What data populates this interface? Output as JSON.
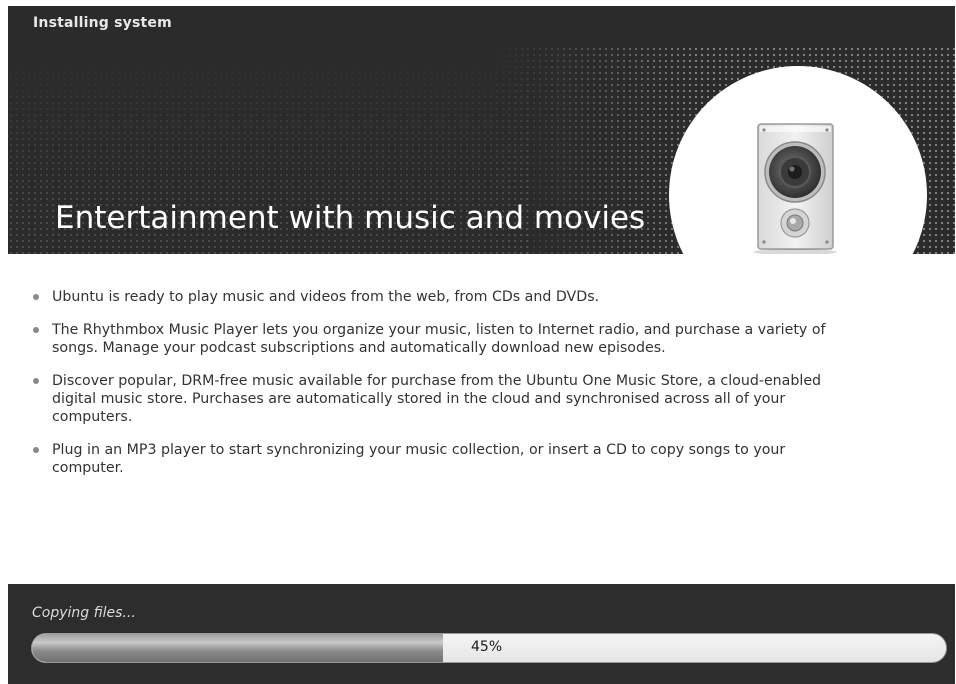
{
  "window": {
    "title": "Installing system"
  },
  "slide": {
    "title": "Entertainment with music and movies",
    "illustration_icon": "speaker-icon",
    "bullets": [
      "Ubuntu is ready to play music and videos from the web, from CDs and DVDs.",
      "The Rhythmbox Music Player lets you organize your music, listen to Internet radio, and purchase a variety of songs. Manage your podcast subscriptions and automatically download new episodes.",
      "Discover popular, DRM-free music available for purchase from the Ubuntu One Music Store, a cloud-enabled digital music store. Purchases are automatically stored in the cloud and synchronised across all of your computers.",
      "Plug in an MP3 player to start synchronizing your music collection, or insert a CD to copy songs to your computer."
    ]
  },
  "progress": {
    "status": "Copying files...",
    "label": "45%",
    "fraction": 0.45
  },
  "colors": {
    "header_bg": "#2b2b2b",
    "footer_bg": "#2d2d2d",
    "content_bg": "#ffffff"
  }
}
